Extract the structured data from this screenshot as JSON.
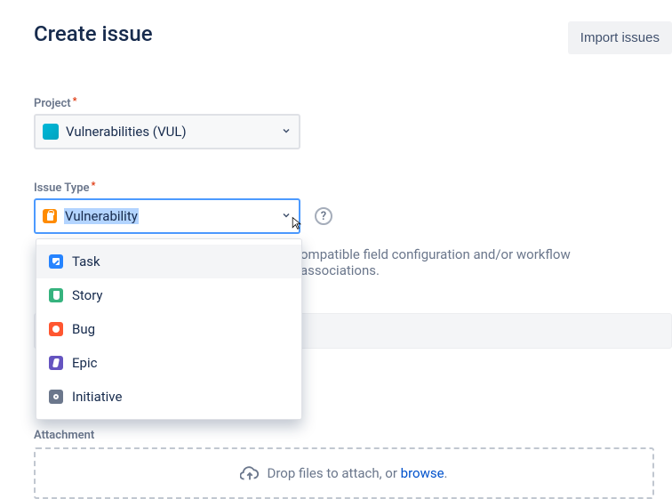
{
  "header": {
    "title": "Create issue",
    "import_button": "Import issues"
  },
  "project_field": {
    "label": "Project",
    "required_marker": "*",
    "value": "Vulnerabilities (VUL)"
  },
  "issuetype_field": {
    "label": "Issue Type",
    "required_marker": "*",
    "value": "Vulnerability",
    "help_tooltip": "?",
    "options": [
      {
        "label": "Task",
        "icon": "task"
      },
      {
        "label": "Story",
        "icon": "story"
      },
      {
        "label": "Bug",
        "icon": "bug"
      },
      {
        "label": "Epic",
        "icon": "epic"
      },
      {
        "label": "Initiative",
        "icon": "initiative"
      }
    ]
  },
  "note_fragment": "ompatible field configuration and/or workflow associations.",
  "attachment": {
    "label": "Attachment",
    "drop_text": "Drop files to attach, or ",
    "browse_text": "browse",
    "period": "."
  }
}
